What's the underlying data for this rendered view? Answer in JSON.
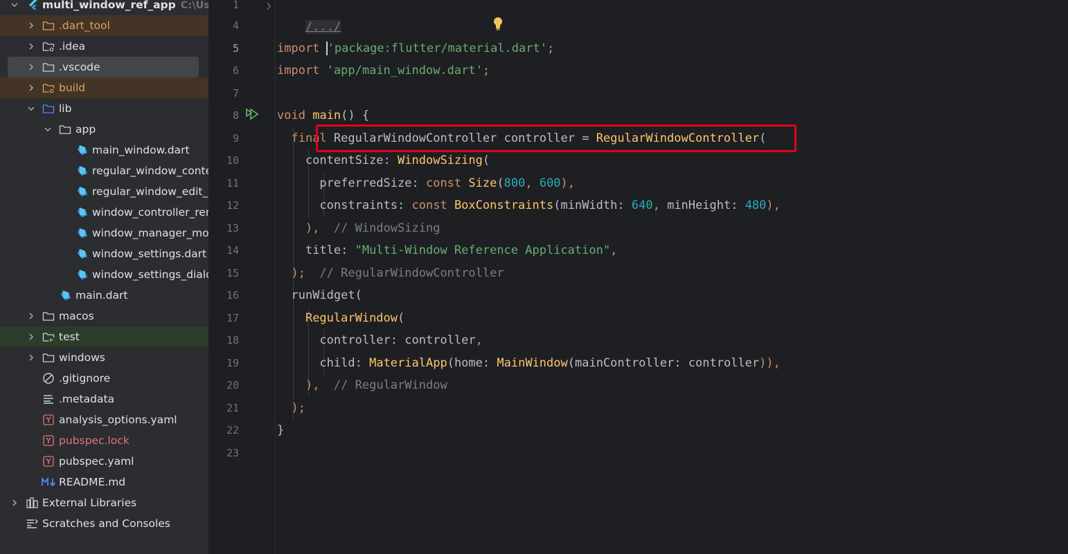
{
  "project": {
    "root_name": "multi_window_ref_app",
    "root_path": "C:\\Users\\",
    "items": [
      {
        "label": "multi_window_ref_app",
        "icon": "flutter-icon",
        "type": "root"
      },
      {
        "label": ".dart_tool",
        "icon": "folder-icon",
        "color": "orange"
      },
      {
        "label": ".idea",
        "icon": "folder-settings-icon"
      },
      {
        "label": ".vscode",
        "icon": "folder-icon"
      },
      {
        "label": "build",
        "icon": "folder-excluded-icon",
        "color": "orange"
      },
      {
        "label": "lib",
        "icon": "folder-source-icon"
      },
      {
        "label": "app",
        "icon": "folder-icon"
      },
      {
        "label": "main_window.dart",
        "icon": "dart-file-icon"
      },
      {
        "label": "regular_window_content",
        "icon": "dart-file-icon"
      },
      {
        "label": "regular_window_edit_dialog",
        "icon": "dart-file-icon"
      },
      {
        "label": "window_controller_render",
        "icon": "dart-file-icon"
      },
      {
        "label": "window_manager_model",
        "icon": "dart-file-icon"
      },
      {
        "label": "window_settings.dart",
        "icon": "dart-file-icon"
      },
      {
        "label": "window_settings_dialog",
        "icon": "dart-file-icon"
      },
      {
        "label": "main.dart",
        "icon": "dart-file-icon"
      },
      {
        "label": "macos",
        "icon": "folder-icon"
      },
      {
        "label": "test",
        "icon": "folder-test-icon"
      },
      {
        "label": "windows",
        "icon": "folder-icon"
      },
      {
        "label": ".gitignore",
        "icon": "ignore-file-icon"
      },
      {
        "label": ".metadata",
        "icon": "text-file-icon"
      },
      {
        "label": "analysis_options.yaml",
        "icon": "yaml-file-icon"
      },
      {
        "label": "pubspec.lock",
        "icon": "yaml-file-icon",
        "color": "red"
      },
      {
        "label": "pubspec.yaml",
        "icon": "yaml-file-icon"
      },
      {
        "label": "README.md",
        "icon": "markdown-file-icon"
      },
      {
        "label": "External Libraries",
        "icon": "library-icon"
      },
      {
        "label": "Scratches and Consoles",
        "icon": "scratches-icon"
      }
    ]
  },
  "editor": {
    "line_numbers": [
      "1",
      "4",
      "5",
      "6",
      "7",
      "8",
      "9",
      "10",
      "11",
      "12",
      "13",
      "14",
      "15",
      "16",
      "17",
      "18",
      "19",
      "20",
      "21",
      "22",
      "23"
    ],
    "current_line": "5",
    "folded_text": "/.../",
    "lines": {
      "l5": {
        "kw": "import",
        "str": "'package:flutter/material.dart'",
        "end": ";"
      },
      "l6": {
        "kw": "import",
        "str": "'app/main_window.dart'",
        "end": ";"
      },
      "l8": {
        "kw": "void",
        "fn": "main",
        "rest": "() {"
      },
      "l9": {
        "kw": "final",
        "cls": "RegularWindowController",
        "id": "controller",
        "op": "=",
        "ctor": "RegularWindowController",
        "open": "("
      },
      "l10": {
        "param": "contentSize:",
        "ctor": "WindowSizing",
        "open": "("
      },
      "l11": {
        "param": "preferredSize:",
        "kw": "const",
        "ctor": "Size",
        "open": "(",
        "n1": "800",
        "sep": ",",
        "n2": "600",
        "close": "),"
      },
      "l12": {
        "param": "constraints:",
        "kw": "const",
        "ctor": "BoxConstraints",
        "open": "(",
        "p1": "minWidth:",
        "n1": "640",
        "sep": ",",
        "p2": "minHeight:",
        "n2": "480",
        "close": "),"
      },
      "l13": {
        "close": "),",
        "cmt": "// WindowSizing"
      },
      "l14": {
        "param": "title:",
        "str": "\"Multi-Window Reference Application\"",
        "end": ","
      },
      "l15": {
        "close": ");",
        "cmt": "// RegularWindowController"
      },
      "l16": {
        "fn": "runWidget",
        "open": "("
      },
      "l17": {
        "ctor": "RegularWindow",
        "open": "("
      },
      "l18": {
        "param": "controller:",
        "id": "controller",
        "end": ","
      },
      "l19": {
        "param": "child:",
        "ctor": "MaterialApp",
        "p1": "home:",
        "ctor2": "MainWindow",
        "p2": "mainController:",
        "id": "controller",
        "close": ")),"
      },
      "l20": {
        "close": "),",
        "cmt": "// RegularWindow"
      },
      "l21": {
        "close": ");"
      },
      "l22": {
        "close": "}"
      }
    }
  },
  "colors": {
    "highlight_box": "#e3001b",
    "run_gutter_icon": "#5fb865",
    "intention_bulb": "#f2c55c"
  }
}
